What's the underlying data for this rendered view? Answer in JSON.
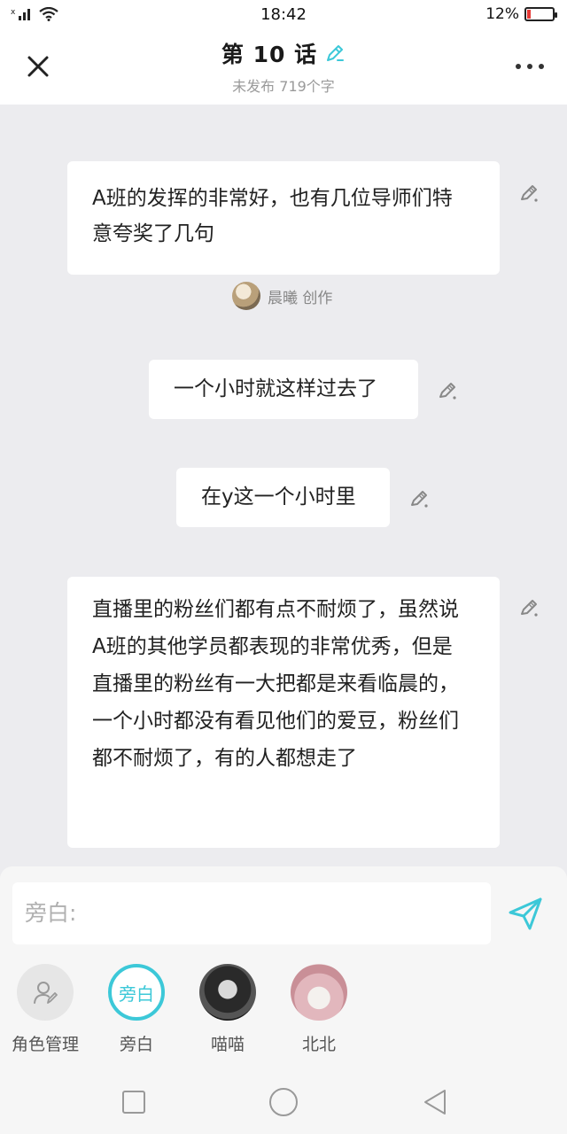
{
  "status_bar": {
    "time": "18:42",
    "battery": "12%",
    "signal_mark": "x"
  },
  "header": {
    "title": "第 10 话",
    "subtitle": "未发布 719个字"
  },
  "messages": [
    {
      "text": "A班的发挥的非常好，也有几位导师们特意夸奖了几句"
    },
    {
      "text": "一个小时就这样过去了"
    },
    {
      "text": "在y这一个小时里"
    },
    {
      "text": "直播里的粉丝们都有点不耐烦了，虽然说A班的其他学员都表现的非常优秀，但是直播里的粉丝有一大把都是来看临晨的，一个小时都没有看见他们的爱豆，粉丝们都不耐烦了，有的人都想走了"
    }
  ],
  "author": {
    "name": "晨曦 创作"
  },
  "composer": {
    "placeholder": "旁白:"
  },
  "roles": [
    {
      "label": "角色管理",
      "icon": "role-manage-icon"
    },
    {
      "label": "旁白",
      "avatar_text": "旁白",
      "selected": true
    },
    {
      "label": "喵喵"
    },
    {
      "label": "北北"
    }
  ],
  "colors": {
    "accent": "#3cc8d8",
    "background": "#ececef",
    "bubble": "#ffffff"
  }
}
